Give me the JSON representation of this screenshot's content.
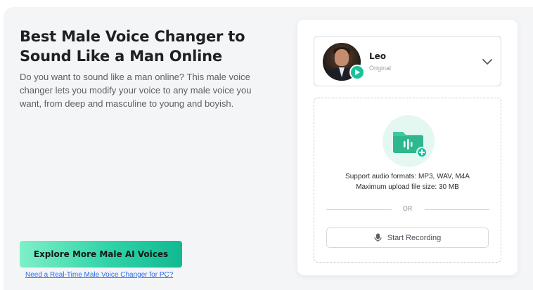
{
  "hero": {
    "title_line1": "Best Male Voice Changer to",
    "title_line2": "Sound Like a Man Online",
    "description": "Do you want to sound like a man online? This male voice changer lets you modify your voice to any male voice you want, from deep and masculine to young and boyish."
  },
  "cta": {
    "button_label": "Explore More Male AI Voices",
    "link_label": "Need a Real-Time Male Voice Changer for PC?"
  },
  "voice_selector": {
    "name": "Leo",
    "subtitle": "Original"
  },
  "upload": {
    "formats_text": "Support audio formats: MP3, WAV, M4A",
    "max_size_text": "Maximum upload file size: 30 MB",
    "or_label": "OR",
    "record_label": "Start Recording"
  },
  "colors": {
    "accent": "#19c29b",
    "cta_gradient_start": "#7ef0c8",
    "cta_gradient_end": "#11b991",
    "link": "#2a6ef0"
  },
  "icons": {
    "play": "play-icon",
    "chevron": "chevron-down-icon",
    "folder": "audio-folder-icon",
    "mic": "microphone-icon"
  }
}
